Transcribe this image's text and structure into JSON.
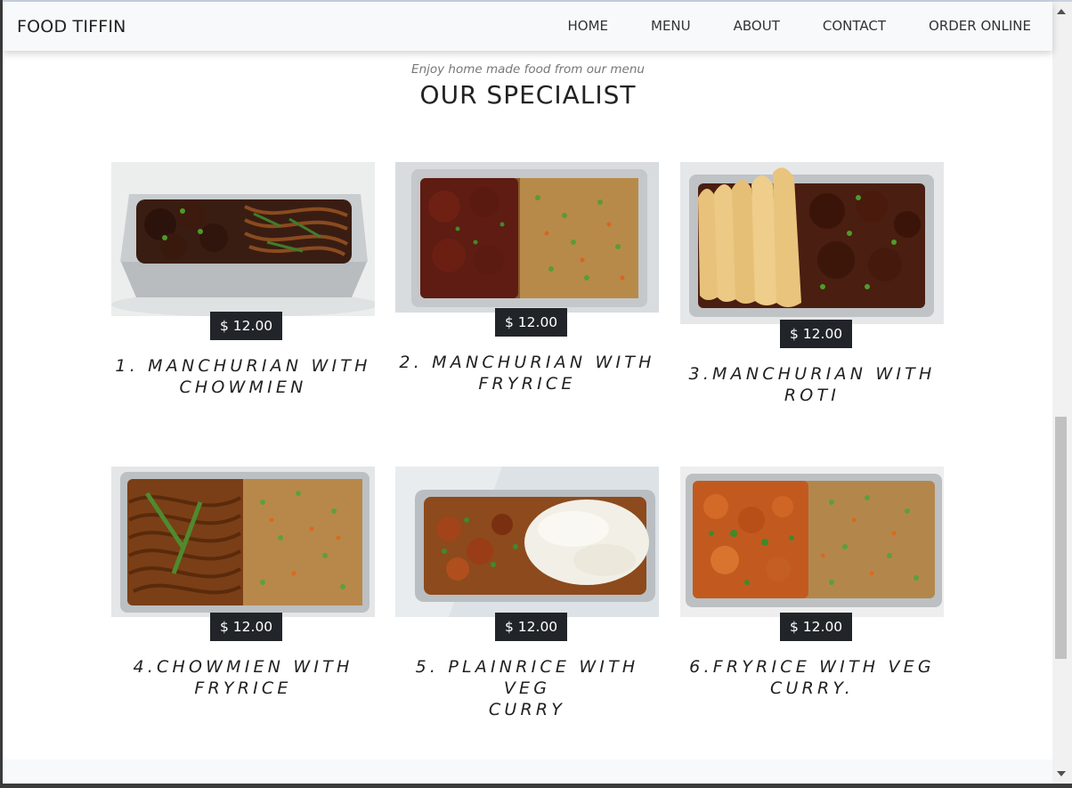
{
  "navbar": {
    "brand": "FOOD TIFFIN",
    "links": [
      "HOME",
      "MENU",
      "ABOUT",
      "CONTACT",
      "ORDER ONLINE"
    ]
  },
  "section": {
    "subtitle": "Enjoy home made food from our menu",
    "title": "OUR SPECIALIST"
  },
  "menu_items": [
    {
      "price": "$ 12.00",
      "name_line1": "1. MANCHURIAN WITH",
      "name_line2": "CHOWMIEN",
      "image": "manchurian-chowmien-tray"
    },
    {
      "price": "$ 12.00",
      "name_line1": "2. MANCHURIAN WITH",
      "name_line2": "FRYRICE",
      "image": "manchurian-fryrice-tray"
    },
    {
      "price": "$ 12.00",
      "name_line1": "3.MANCHURIAN WITH",
      "name_line2": "ROTI",
      "image": "manchurian-roti-tray"
    },
    {
      "price": "$ 12.00",
      "name_line1": "4.CHOWMIEN WITH",
      "name_line2": "FRYRICE",
      "image": "chowmien-fryrice-tray"
    },
    {
      "price": "$ 12.00",
      "name_line1": "5. PLAINRICE WITH VEG",
      "name_line2": "CURRY",
      "image": "plainrice-vegcurry-tray"
    },
    {
      "price": "$ 12.00",
      "name_line1": "6.FRYRICE WITH VEG",
      "name_line2": "CURRY.",
      "image": "fryrice-vegcurry-tray"
    }
  ],
  "colors": {
    "navbar_bg": "#f8f9fa",
    "price_badge_bg": "#212529",
    "price_badge_text": "#ffffff",
    "subtitle_text": "#777777"
  }
}
